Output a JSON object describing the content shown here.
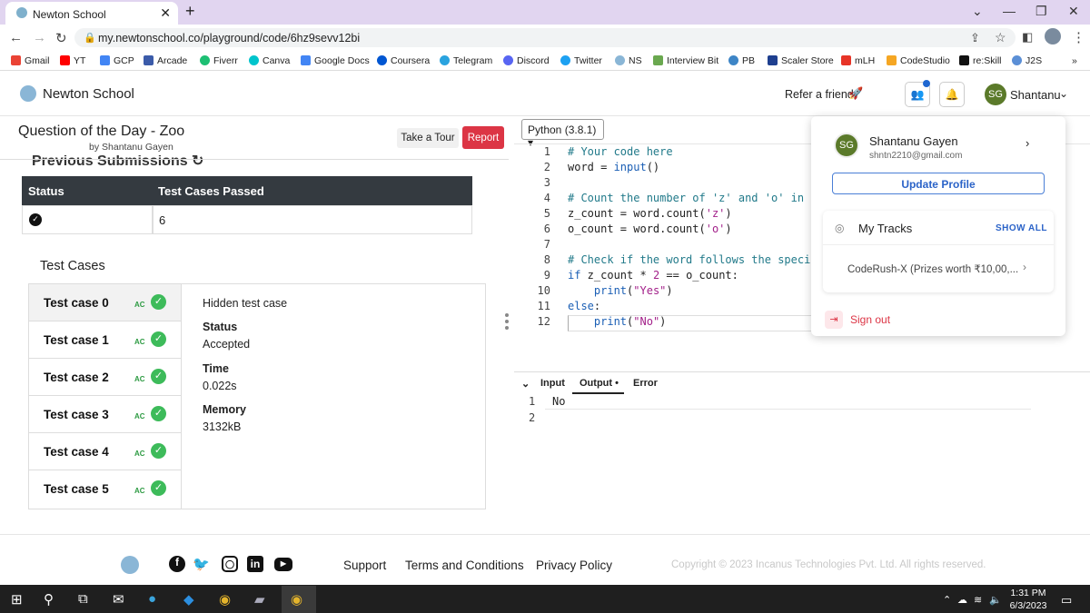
{
  "browser": {
    "tab_title": "Newton School",
    "url": "my.newtonschool.co/playground/code/6hz9sevv12bi",
    "bookmarks": [
      "Gmail",
      "YT",
      "GCP",
      "Arcade",
      "Fiverr",
      "Canva",
      "Google Docs",
      "Coursera",
      "Telegram",
      "Discord",
      "Twitter",
      "NS",
      "Interview Bit",
      "PB",
      "Scaler Store",
      "mLH",
      "CodeStudio",
      "re:Skill",
      "J2S"
    ]
  },
  "header": {
    "brand": "Newton School",
    "refer_label": "Refer a friend",
    "avatar_initials": "SG",
    "user_name": "Shantanu"
  },
  "question": {
    "title": "Question of the Day - Zoo",
    "author": "by Shantanu Gayen",
    "tour_label": "Take a Tour",
    "report_label": "Report",
    "previous_label": "Previous Submissions"
  },
  "submissions": {
    "headers": [
      "Status",
      "Test Cases Passed"
    ],
    "rows": [
      {
        "passed": "6"
      }
    ]
  },
  "test_cases": {
    "title": "Test Cases",
    "items": [
      {
        "label": "Test case 0",
        "badge": "AC"
      },
      {
        "label": "Test case 1",
        "badge": "AC"
      },
      {
        "label": "Test case 2",
        "badge": "AC"
      },
      {
        "label": "Test case 3",
        "badge": "AC"
      },
      {
        "label": "Test case 4",
        "badge": "AC"
      },
      {
        "label": "Test case 5",
        "badge": "AC"
      }
    ],
    "detail": {
      "hidden": "Hidden test case",
      "status_label": "Status",
      "status_value": "Accepted",
      "time_label": "Time",
      "time_value": "0.022s",
      "memory_label": "Memory",
      "memory_value": "3132kB"
    }
  },
  "editor": {
    "language": "Python (3.8.1)",
    "lines": [
      "1",
      "2",
      "3",
      "4",
      "5",
      "6",
      "7",
      "8",
      "9",
      "10",
      "11",
      "12"
    ]
  },
  "output": {
    "tabs": [
      "Input",
      "Output",
      "Error"
    ],
    "lines": [
      "No",
      ""
    ]
  },
  "dropdown": {
    "avatar_initials": "SG",
    "name": "Shantanu Gayen",
    "email": "shntn2210@gmail.com",
    "update_label": "Update Profile",
    "tracks_title": "My Tracks",
    "show_all": "SHOW ALL",
    "track": "CodeRush-X (Prizes worth ₹10,00,...",
    "sign_out": "Sign out"
  },
  "footer": {
    "support": "Support",
    "terms": "Terms and Conditions",
    "privacy": "Privacy Policy",
    "copyright": "Copyright © 2023 Incanus Technologies Pvt. Ltd. All rights reserved."
  },
  "taskbar": {
    "time": "1:31 PM",
    "date": "6/3/2023"
  }
}
